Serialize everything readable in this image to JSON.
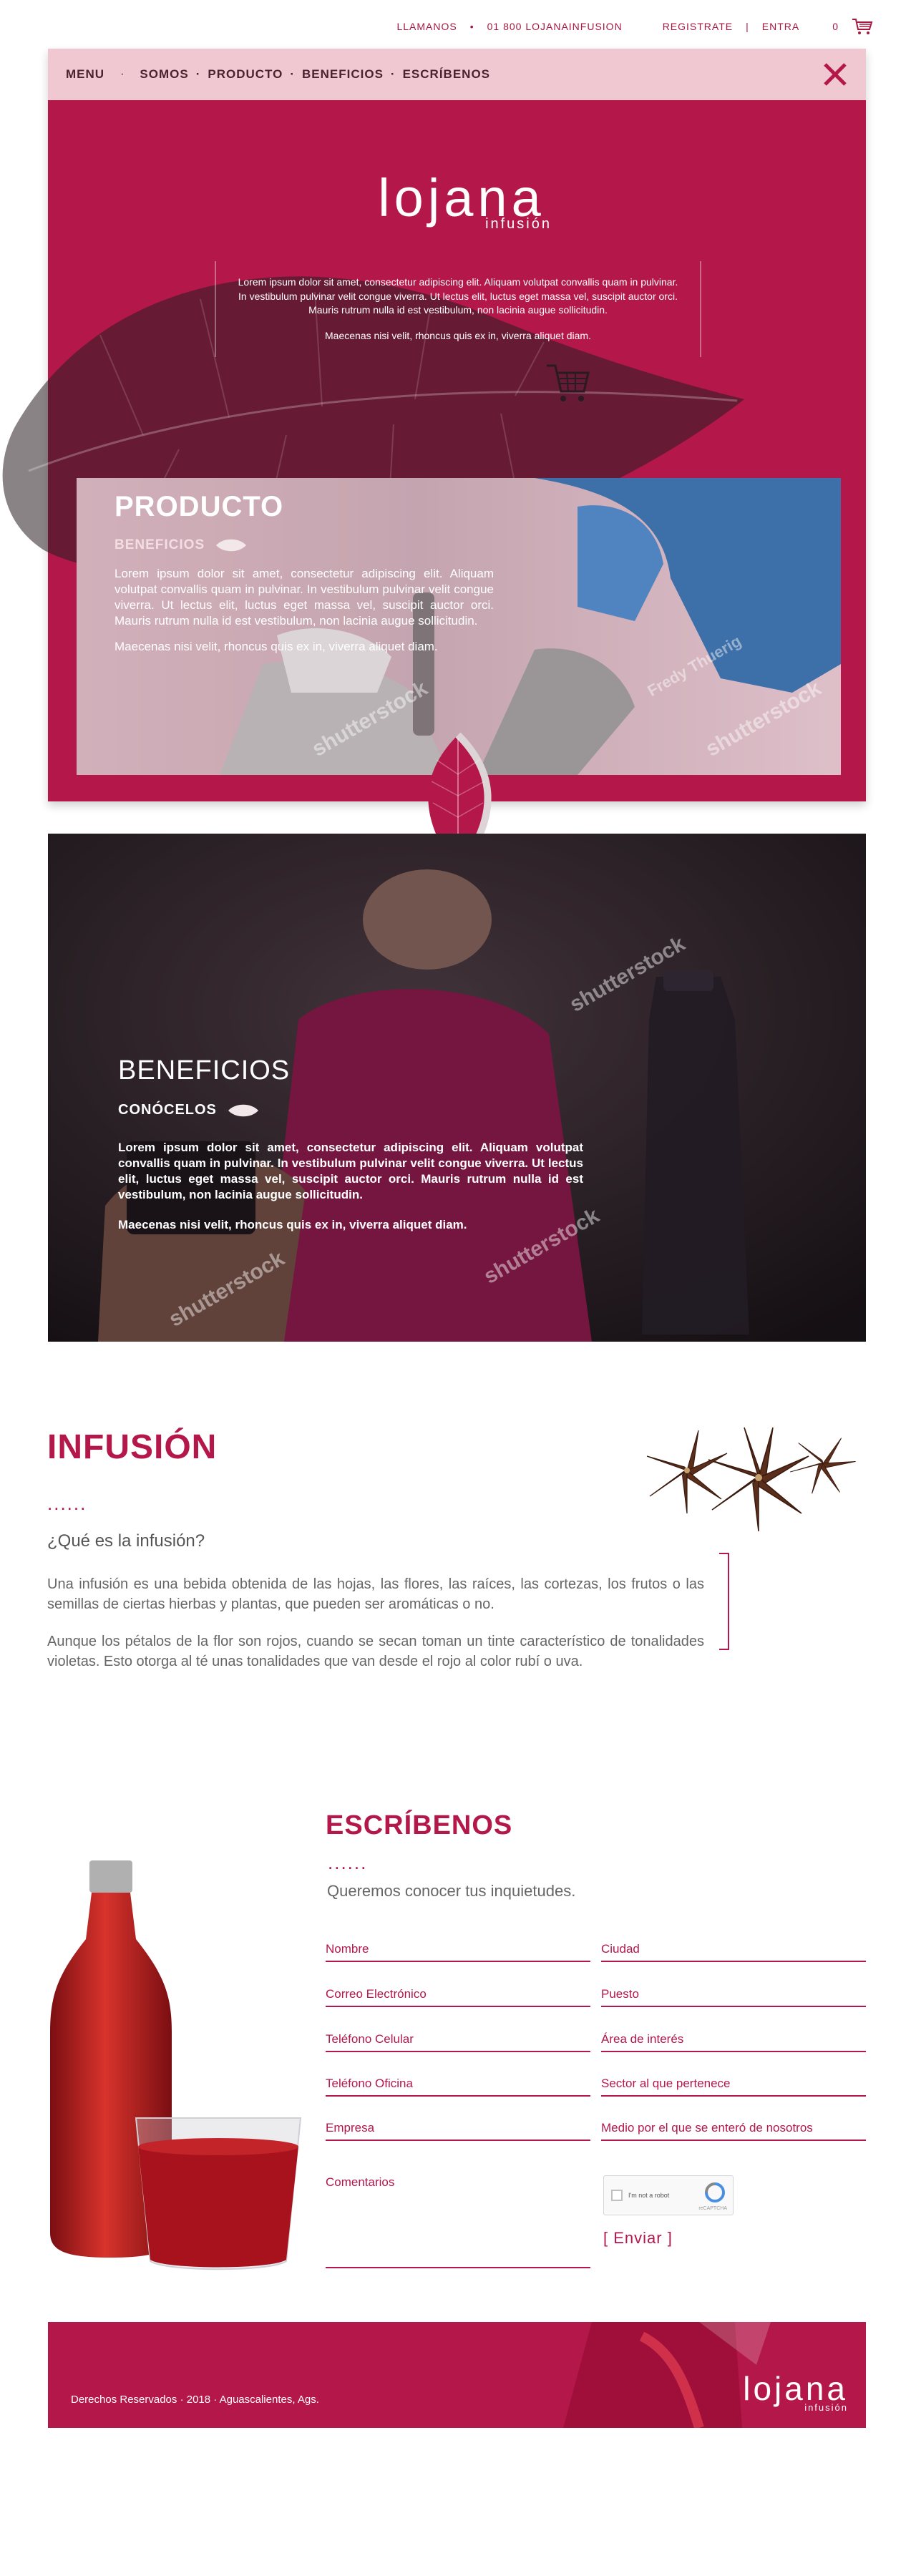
{
  "topbar": {
    "call_label": "LLAMANOS",
    "phone": "01 800 LOJANAINFUSION",
    "register_label": "REGISTRATE",
    "login_label": "ENTRA",
    "cart_count": "0"
  },
  "nav": {
    "menu_label": "MENU",
    "links": [
      "SOMOS",
      "PRODUCTO",
      "BENEFICIOS",
      "ESCRÍBENOS"
    ]
  },
  "brand": {
    "name": "lojana",
    "tagline": "infusión"
  },
  "intro": {
    "p1": "Lorem ipsum dolor sit amet, consectetur adipiscing elit. Aliquam volutpat convallis quam in pulvinar. In vestibulum pulvinar velit congue viverra. Ut lectus elit, luctus eget massa vel, suscipit auctor orci. Mauris rutrum nulla id est vestibulum, non lacinia augue sollicitudin.",
    "p2": "Maecenas nisi velit, rhoncus quis ex in, viverra aliquet diam."
  },
  "producto": {
    "title": "PRODUCTO",
    "link": "BENEFICIOS",
    "p1": "Lorem ipsum dolor sit amet, consectetur adipiscing elit. Aliquam volutpat convallis quam in pulvinar. In vestibulum pulvinar velit congue viverra. Ut lectus elit, luctus eget massa vel, suscipit auctor orci. Mauris rutrum nulla id est vestibulum, non lacinia augue sollicitudin.",
    "p2": "Maecenas nisi velit, rhoncus quis ex in, viverra aliquet diam.",
    "watermark": "shutterstock",
    "credit": "Fredy Thuerig"
  },
  "beneficios": {
    "title": "BENEFICIOS",
    "link": "CONÓCELOS",
    "p1": "Lorem ipsum dolor sit amet, consectetur adipiscing elit. Aliquam volutpat convallis quam in pulvinar. In vestibulum pulvinar velit congue viverra. Ut lectus elit, luctus eget massa vel, suscipit auctor orci. Mauris rutrum nulla id est vestibulum, non lacinia augue sollicitudin.",
    "p2": "Maecenas nisi velit, rhoncus quis ex in, viverra aliquet diam.",
    "watermark": "shutterstock"
  },
  "infusion": {
    "title": "INFUSIÓN",
    "dots": "......",
    "question": "¿Qué es la infusión?",
    "p1": "Una infusión es una bebida obtenida de las hojas, las flores, las raíces, las cortezas, los frutos o las semillas de ciertas hierbas y plantas, que pueden ser aromáticas o no.",
    "p2": "Aunque los pétalos de la flor son rojos, cuando se secan toman un tinte característico de tonalidades violetas. Esto otorga al té unas tonalidades que van desde el rojo al color rubí o uva."
  },
  "contact": {
    "title": "ESCRÍBENOS",
    "dots": "......",
    "subtitle": "Queremos conocer tus inquietudes.",
    "fields": {
      "nombre": "Nombre",
      "ciudad": "Ciudad",
      "correo": "Correo Electrónico",
      "puesto": "Puesto",
      "celular": "Teléfono Celular",
      "area": "Área de interés",
      "oficina": "Teléfono  Oficina",
      "sector": "Sector al que pertenece",
      "empresa": "Empresa",
      "medio": "Medio por el que se enteró de nosotros",
      "comentarios": "Comentarios"
    },
    "captcha_label": "I'm not a robot",
    "captcha_brand": "reCAPTCHA",
    "send_label": "[ Enviar ]"
  },
  "footer": {
    "rights": "Derechos Reservados · 2018 · Aguascalientes, Ags."
  },
  "colors": {
    "brand": "#b4174a",
    "nav_bg": "#efc8d2"
  },
  "icons": [
    "cart-icon",
    "close-icon",
    "leaf-icon"
  ]
}
